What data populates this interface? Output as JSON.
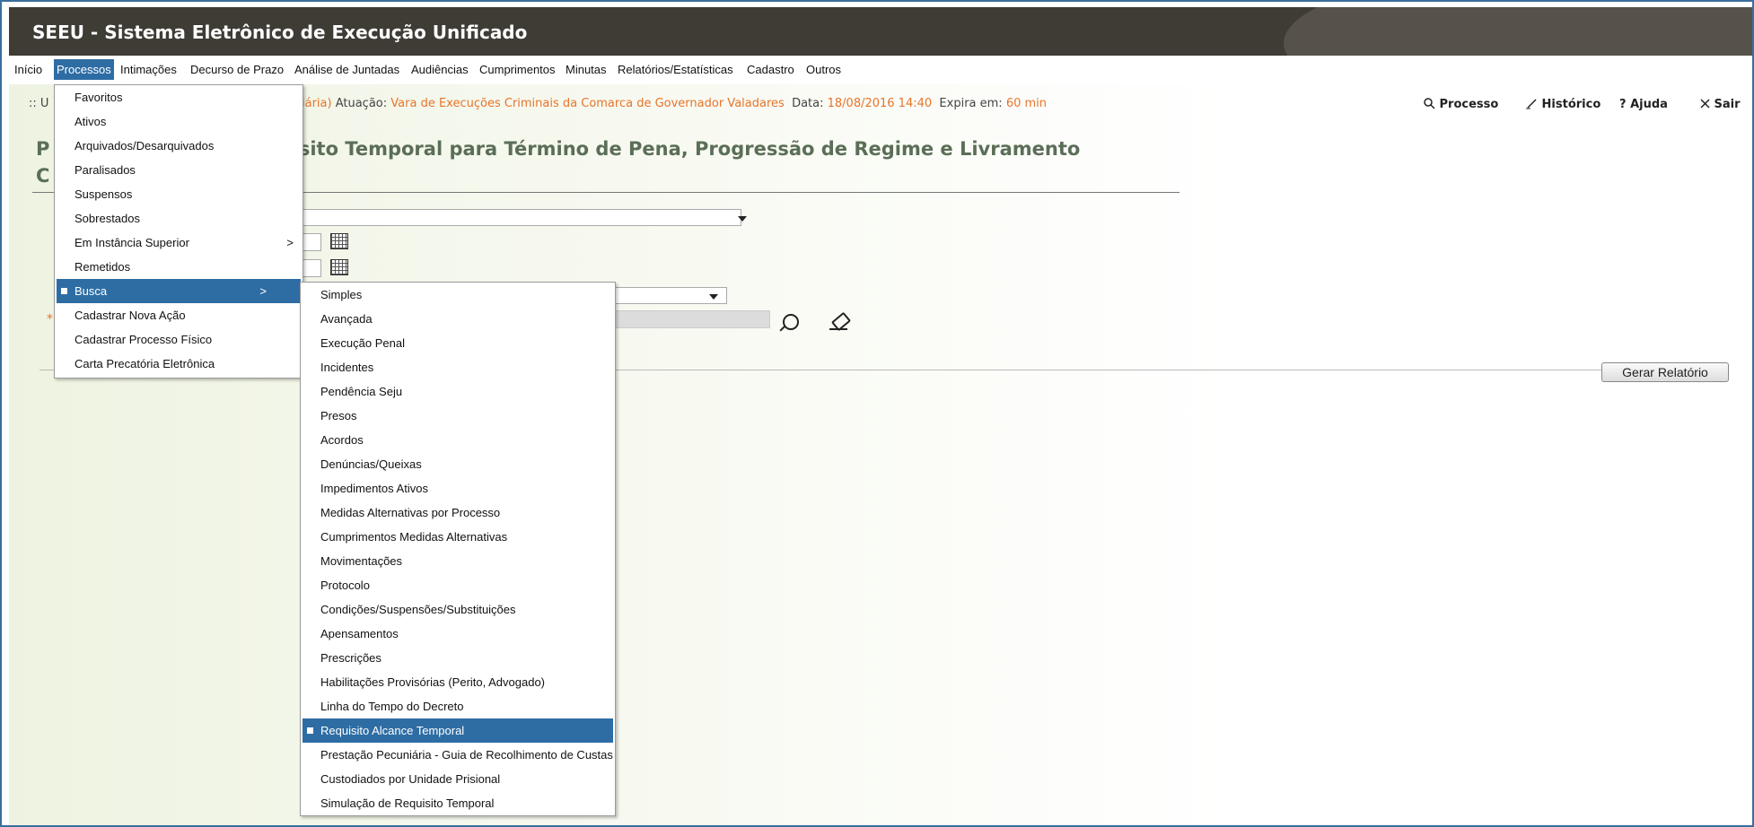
{
  "app": {
    "title": "SEEU - Sistema Eletrônico de Execução Unificado"
  },
  "menubar": {
    "items": [
      {
        "label": "Início"
      },
      {
        "label": "Processos"
      },
      {
        "label": "Intimações"
      },
      {
        "label": "Decurso de Prazo"
      },
      {
        "label": "Análise de Juntadas"
      },
      {
        "label": "Audiências"
      },
      {
        "label": "Cumprimentos"
      },
      {
        "label": "Minutas"
      },
      {
        "label": "Relatórios/Estatísticas"
      },
      {
        "label": "Cadastro"
      },
      {
        "label": "Outros"
      }
    ]
  },
  "info": {
    "prefix": ":: U",
    "partial": "iária)",
    "atuacao_label": "Atuação:",
    "atuacao_value": "Vara de Execuções Criminais da Comarca de Governador Valadares",
    "data_label": "Data:",
    "data_value": "18/08/2016 14:40",
    "expira_label": "Expira em:",
    "expira_value": "60 min"
  },
  "toplinks": {
    "processo": "Processo",
    "historico": "Histórico",
    "ajuda": "Ajuda",
    "sair": "Sair"
  },
  "page": {
    "title_start": "P",
    "title_rest": "equisito Temporal para Término de Pena, Progressão de Regime e Livramento",
    "title_line2": "C",
    "required_marker": "*",
    "generate_button": "Gerar Relatório"
  },
  "processos_menu": {
    "items": [
      {
        "label": "Favoritos"
      },
      {
        "label": "Ativos"
      },
      {
        "label": "Arquivados/Desarquivados"
      },
      {
        "label": "Paralisados"
      },
      {
        "label": "Suspensos"
      },
      {
        "label": "Sobrestados"
      },
      {
        "label": "Em Instância Superior",
        "submenu_marker": ">"
      },
      {
        "label": "Remetidos"
      },
      {
        "label": "Busca",
        "submenu_marker": ">"
      },
      {
        "label": "Cadastrar Nova Ação"
      },
      {
        "label": "Cadastrar Processo Físico"
      },
      {
        "label": "Carta Precatória Eletrônica"
      }
    ]
  },
  "busca_menu": {
    "items": [
      {
        "label": "Simples"
      },
      {
        "label": "Avançada"
      },
      {
        "label": "Execução Penal"
      },
      {
        "label": "Incidentes"
      },
      {
        "label": "Pendência Seju"
      },
      {
        "label": "Presos"
      },
      {
        "label": "Acordos"
      },
      {
        "label": "Denúncias/Queixas"
      },
      {
        "label": "Impedimentos Ativos"
      },
      {
        "label": "Medidas Alternativas por Processo"
      },
      {
        "label": "Cumprimentos Medidas Alternativas"
      },
      {
        "label": "Movimentações"
      },
      {
        "label": "Protocolo"
      },
      {
        "label": "Condições/Suspensões/Substituições"
      },
      {
        "label": "Apensamentos"
      },
      {
        "label": "Prescrições"
      },
      {
        "label": "Habilitações Provisórias (Perito, Advogado)"
      },
      {
        "label": "Linha do Tempo do Decreto"
      },
      {
        "label": "Requisito Alcance Temporal"
      },
      {
        "label": "Prestação Pecuniária - Guia de Recolhimento de Custas"
      },
      {
        "label": "Custodiados por Unidade Prisional"
      },
      {
        "label": "Simulação de Requisito Temporal"
      }
    ]
  },
  "icons": {
    "search": "search-icon",
    "eraser": "eraser-icon",
    "calendar": "calendar-icon",
    "pencil": "pencil-icon",
    "help": "help-icon",
    "close": "close-icon"
  },
  "colors": {
    "header": "#3f3b35",
    "accent": "#2e6da4",
    "highlight": "#e8742a",
    "title": "#5b6e57"
  }
}
